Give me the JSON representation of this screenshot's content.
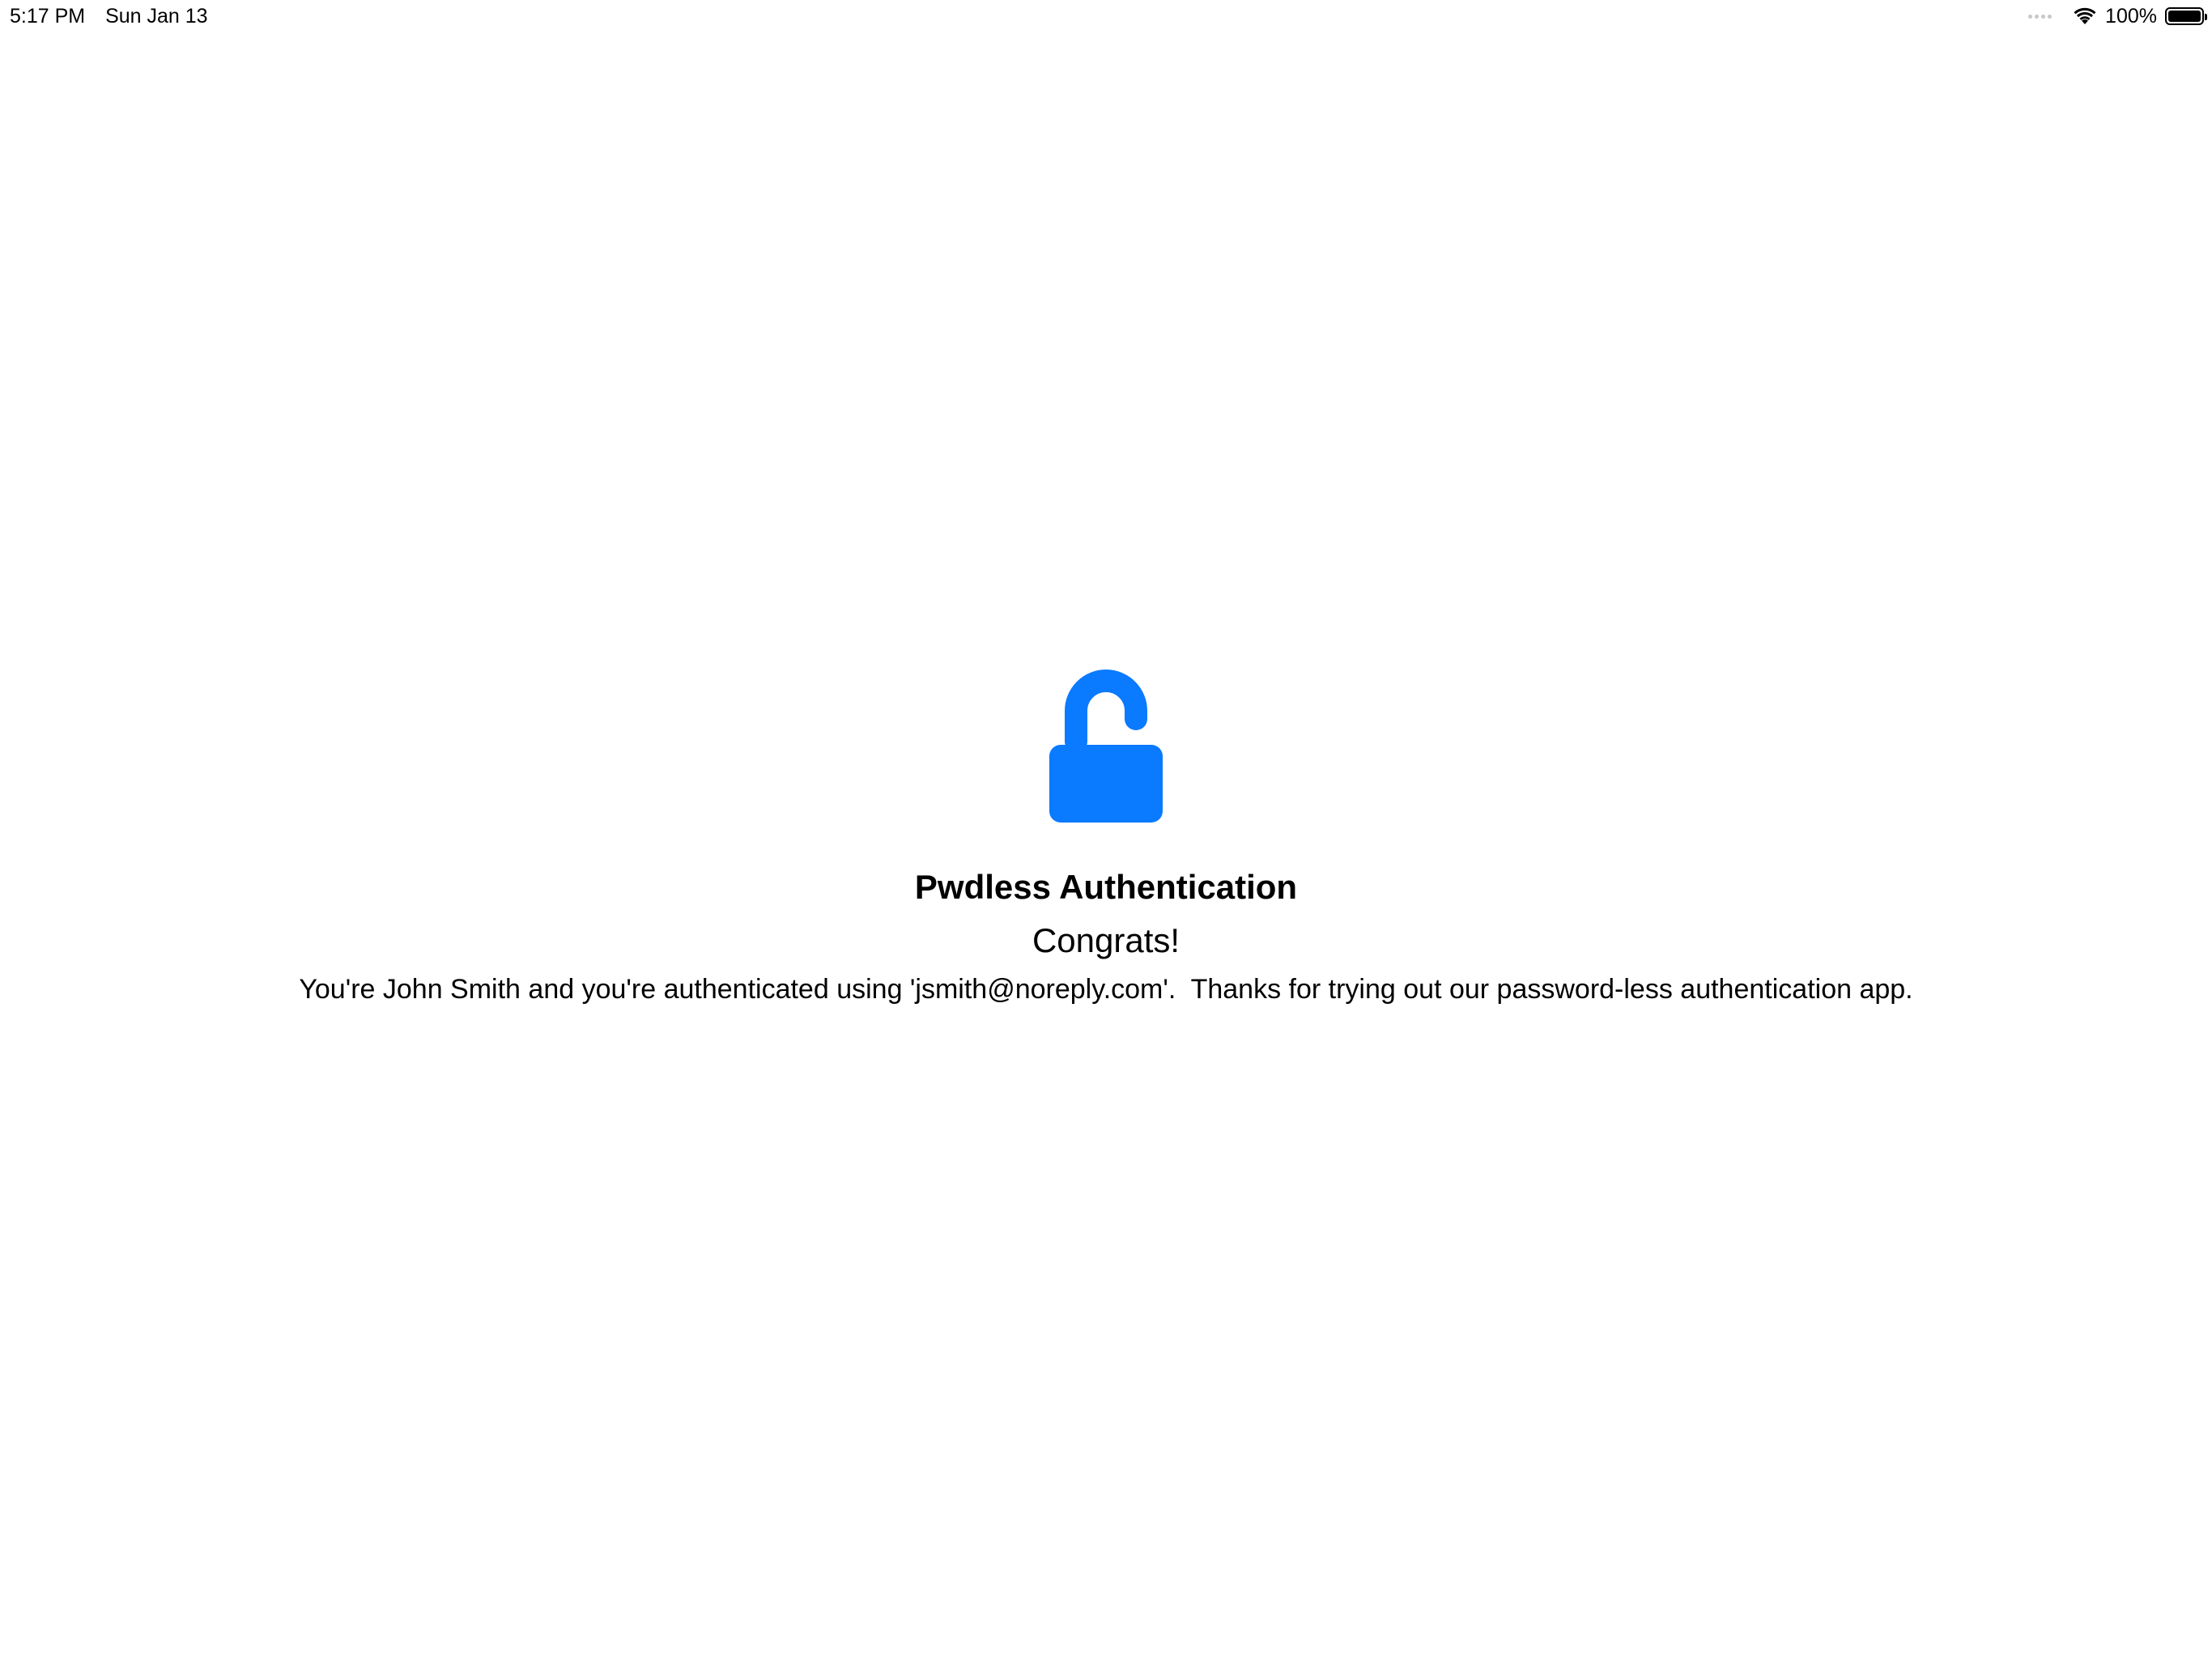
{
  "status_bar": {
    "time": "5:17 PM",
    "date": "Sun Jan 13",
    "battery_percent": "100%",
    "battery_level": 1.0,
    "icons": [
      "cellular-signal-icon",
      "wifi-icon",
      "battery-icon"
    ]
  },
  "main": {
    "icon": "unlocked-padlock-icon",
    "title": "Pwdless Authentication",
    "subtitle": "Congrats!",
    "message": "You're John Smith and you're authenticated using 'jsmith@noreply.com'.  Thanks for trying out our password-less authentication app."
  },
  "colors": {
    "accent": "#0A7AFF",
    "background": "#FFFFFF",
    "text": "#000000"
  }
}
